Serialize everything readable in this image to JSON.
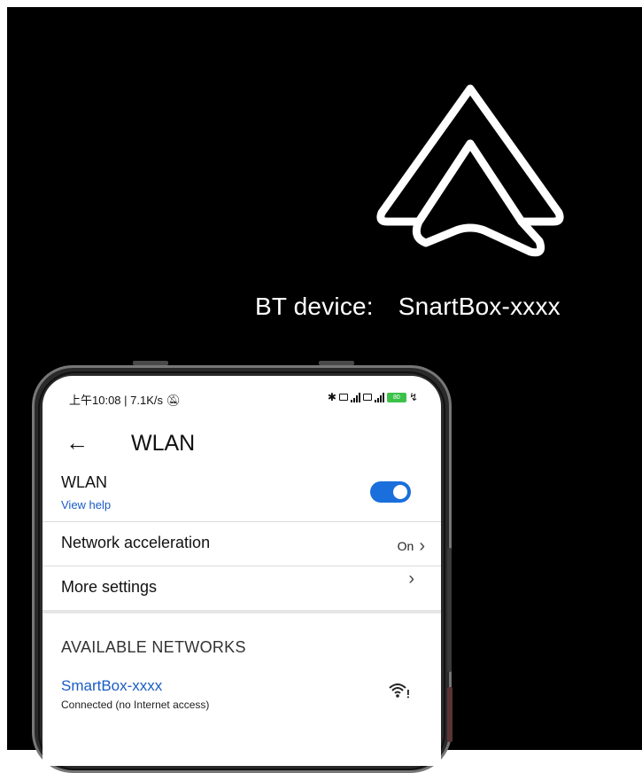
{
  "caption": {
    "label": "BT device:",
    "device_name": "SnartBox-xxxx"
  },
  "status_bar": {
    "time_speed": "上午10:08 | 7.1K/s",
    "mute_icon": "mute-icon",
    "bluetooth_icon": "bluetooth-icon",
    "battery_level": "80",
    "colors": {
      "battery": "#3cc24a"
    }
  },
  "header": {
    "back_icon": "back-arrow-icon",
    "title": "WLAN"
  },
  "wlan": {
    "label": "WLAN",
    "help_link": "View help",
    "enabled": true,
    "colors": {
      "toggle_on": "#1a6fdc",
      "link": "#1a5cc4"
    }
  },
  "settings": [
    {
      "label": "Network acceleration",
      "value": "On"
    },
    {
      "label": "More settings",
      "value": ""
    }
  ],
  "available": {
    "heading": "AVAILABLE NETWORKS",
    "networks": [
      {
        "name": "SmartBox-xxxx",
        "status": "Connected (no Internet access)",
        "icon": "wifi-no-internet-icon"
      }
    ]
  }
}
